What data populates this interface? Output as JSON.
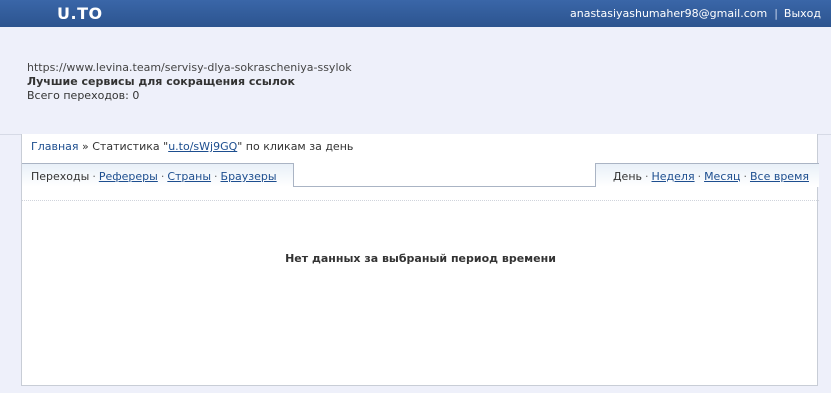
{
  "header": {
    "logo": "U.TO",
    "user_email": "anastasiyashumaher98@gmail.com",
    "separator": "|",
    "logout_label": "Выход"
  },
  "link_info": {
    "url": "https://www.levina.team/servisy-dlya-sokrascheniya-ssylok",
    "title": "Лучшие сервисы для сокращения ссылок",
    "clicks_label": "Всего переходов: 0"
  },
  "breadcrumb": {
    "home": "Главная",
    "sep": "»",
    "stats_prefix": "Статистика \"",
    "short_link": "u.to/sWj9GQ",
    "stats_suffix": "\" по кликам за день"
  },
  "tabs_left": {
    "items": [
      "Переходы",
      "Рефереры",
      "Страны",
      "Браузеры"
    ],
    "current_index": 0
  },
  "tabs_right": {
    "items": [
      "День",
      "Неделя",
      "Месяц",
      "Все время"
    ],
    "current_index": 0
  },
  "dot": "·",
  "message": "Нет данных за выбраный период времени"
}
